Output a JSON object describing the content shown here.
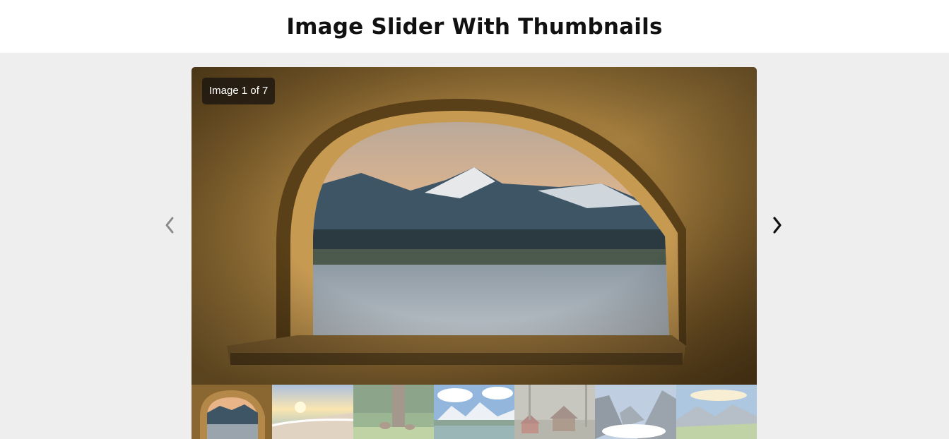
{
  "page": {
    "title": "Image Slider With Thumbnails"
  },
  "slider": {
    "counter_text": "Image 1 of 7",
    "current_index": 1,
    "total": 7,
    "main_image": "arched-window-mountain-lake"
  },
  "controls": {
    "prev_icon": "chevron-left-icon",
    "next_icon": "chevron-right-icon"
  },
  "thumbnails": [
    {
      "subject": "arched-window-mountain-lake",
      "active": true
    },
    {
      "subject": "sunset-beach-waves",
      "active": false
    },
    {
      "subject": "deer-in-forest",
      "active": false
    },
    {
      "subject": "snowy-mountains-lake",
      "active": false
    },
    {
      "subject": "cabins-in-woods",
      "active": false
    },
    {
      "subject": "mountain-valley-clouds",
      "active": false
    },
    {
      "subject": "alpine-meadow-peaks",
      "active": false
    }
  ]
}
